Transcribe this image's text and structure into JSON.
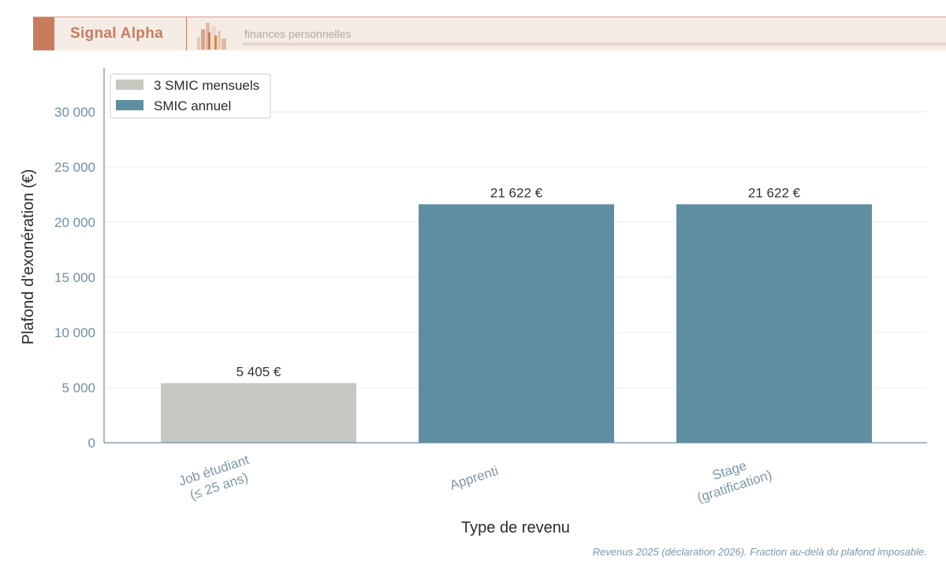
{
  "header": {
    "brand": "Signal Alpha",
    "tagline": "finances personnelles"
  },
  "colors": {
    "accent": "#c97c5d",
    "bar_grey": "#c7c8c1",
    "bar_blue": "#5e8fa1",
    "axis": "#6f8fa3"
  },
  "chart_data": {
    "type": "bar",
    "categories": [
      [
        "Job étudiant",
        "(≤ 25 ans)"
      ],
      [
        "Apprenti"
      ],
      [
        "Stage",
        "(gratification)"
      ]
    ],
    "values": [
      5405,
      21622,
      21622
    ],
    "value_labels": [
      "5 405 €",
      "21 622 €",
      "21 622 €"
    ],
    "bar_series": [
      0,
      1,
      1
    ],
    "series": [
      {
        "name": "3 SMIC mensuels",
        "color": "#c7c8c1"
      },
      {
        "name": "SMIC annuel",
        "color": "#5e8fa1"
      }
    ],
    "yticks": [
      0,
      5000,
      10000,
      15000,
      20000,
      25000,
      30000
    ],
    "ytick_labels": [
      "0",
      "5 000",
      "10 000",
      "15 000",
      "20 000",
      "25 000",
      "30 000"
    ],
    "ylim": [
      0,
      34000
    ],
    "xlabel": "Type de revenu",
    "ylabel": "Plafond d'exonération (€)",
    "legend_position": "top-left",
    "grid": "horizontal",
    "note": "Revenus 2025 (déclaration 2026). Fraction au-delà du plafond imposable."
  }
}
